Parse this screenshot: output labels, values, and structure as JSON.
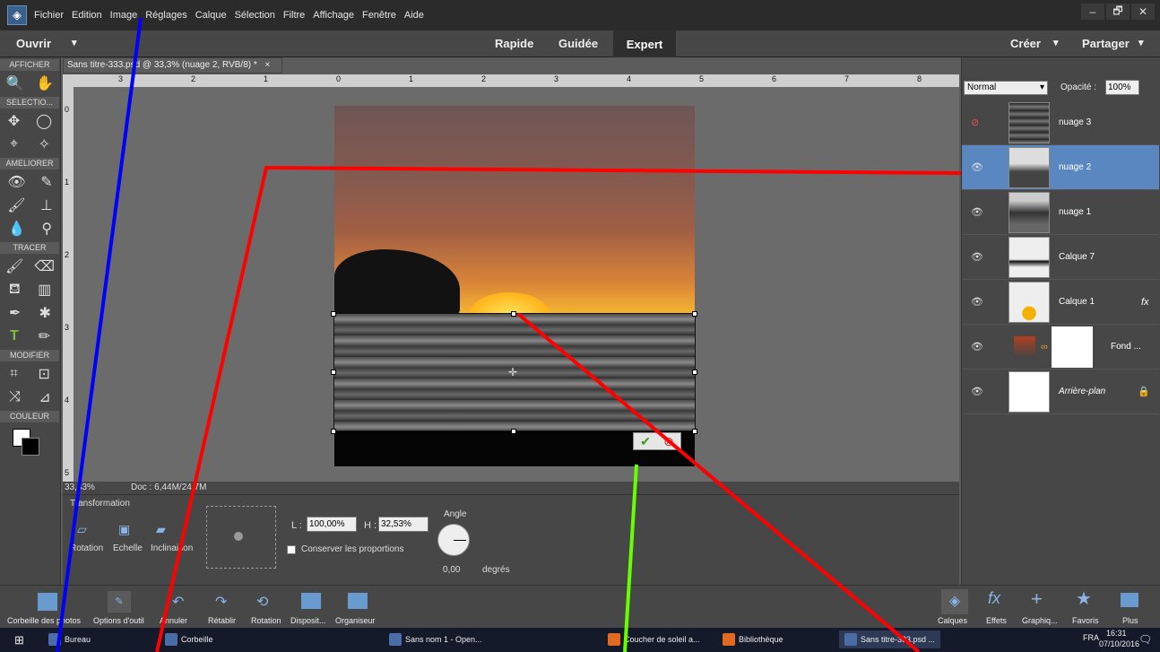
{
  "menu": {
    "items": [
      "Fichier",
      "Edition",
      "Image",
      "Réglages",
      "Calque",
      "Sélection",
      "Filtre",
      "Affichage",
      "Fenêtre",
      "Aide"
    ]
  },
  "window": {
    "minimize": "–",
    "restore": "🗗",
    "close": "✕"
  },
  "modebar": {
    "open": "Ouvrir",
    "open_arrow": "▾",
    "quick": "Rapide",
    "guided": "Guidée",
    "expert": "Expert",
    "create": "Créer",
    "create_arrow": "▾",
    "share": "Partager",
    "share_arrow": "▾"
  },
  "toolbox": {
    "sections": [
      "AFFICHER",
      "SELECTIO...",
      "AMELIORER",
      "TRACER",
      "MODIFIER",
      "COULEUR"
    ]
  },
  "document": {
    "tab": "Sans titre-333.psd @ 33,3% (nuage 2, RVB/8) *",
    "tab_close": "×",
    "zoom": "33,33%",
    "doc_info": "Doc : 6,44M/24,7M"
  },
  "ruler": {
    "h_labels": [
      "3",
      "2",
      "1",
      "0",
      "1",
      "2",
      "3",
      "4",
      "5",
      "6",
      "7",
      "8"
    ],
    "v_labels": [
      "0",
      "1",
      "2",
      "3",
      "4",
      "5"
    ]
  },
  "tool_options": {
    "title": "Transformation",
    "rotation": "Rotation",
    "echelle": "Echelle",
    "inclinaison": "Inclinaison",
    "l_label": "L :",
    "l_value": "100,00%",
    "h_label": "H :",
    "h_value": "32,53%",
    "keep_proportions": "Conserver les proportions",
    "angle_label": "Angle",
    "angle_value": "0,00",
    "angle_unit": "degrés"
  },
  "commit": {
    "ok": "✔",
    "cancel": "⊘"
  },
  "layers_panel": {
    "blend_mode": "Normal",
    "opacity_label": "Opacité :",
    "opacity_value": "100%",
    "layers": [
      {
        "name": "nuage 3",
        "visible": false
      },
      {
        "name": "nuage 2",
        "selected": true
      },
      {
        "name": "nuage 1"
      },
      {
        "name": "Calque 7"
      },
      {
        "name": "Calque 1",
        "fx": "fx"
      },
      {
        "name": "Fond ..."
      },
      {
        "name": "Arrière-plan"
      }
    ]
  },
  "bottombar": {
    "left": [
      "Corbeille des photos",
      "Options d'outil",
      "Annuler",
      "Rétablir",
      "Rotation",
      "Disposit...",
      "Organiseur"
    ],
    "right": [
      "Calques",
      "Effets",
      "Graphiq...",
      "Favoris",
      "Plus"
    ]
  },
  "taskbar": {
    "items": [
      "Bureau",
      "Corbeille",
      "Sans nom 1 - Open...",
      "Coucher de soleil a...",
      "Bibliothèque",
      "Sans titre-333.psd ..."
    ],
    "lang": "FRA",
    "time": "16:31",
    "date": "07/10/2016"
  },
  "colors": {
    "selected_layer": "#5b87c1",
    "annotation_red": "#ff0000",
    "annotation_blue": "#0000ff",
    "annotation_green": "#66ff00"
  }
}
